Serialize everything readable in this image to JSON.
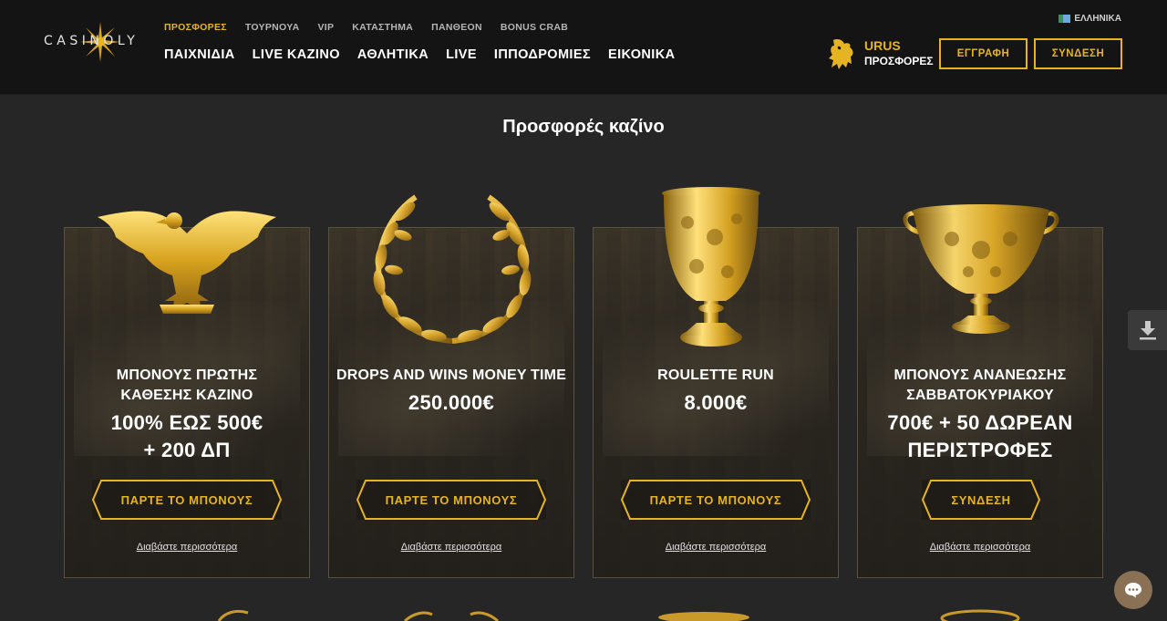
{
  "brand": {
    "logo_text": "CASINOLY"
  },
  "subnav": [
    "ΠΡΟΣΦΟΡΕΣ",
    "ΤΟΥΡΝΟΥΑ",
    "VIP",
    "ΚΑΤΑΣΤΗΜΑ",
    "ΠΑΝΘΕΟΝ",
    "BONUS CRAB"
  ],
  "mainnav": [
    "ΠΑΙΧΝΙΔΙΑ",
    "LIVE ΚΑΖΙΝΟ",
    "ΑΘΛΗΤΙΚΑ",
    "LIVE",
    "ΙΠΠΟΔΡΟΜΙΕΣ",
    "ΕΙΚΟΝΙΚΑ"
  ],
  "language": "ΕΛΛΗΝΙΚΑ",
  "promo": {
    "line1": "URUS",
    "line2": "ΠΡΟΣΦΟΡΕΣ"
  },
  "auth": {
    "register": "ΕΓΓΡΑΦΗ",
    "login": "ΣΥΝΔΕΣΗ"
  },
  "page_title": "Προσφορές καζίνο",
  "cards": [
    {
      "title_line1": "ΜΠΟΝΟΥΣ ΠΡΩΤΗΣ",
      "title_line2": "ΚΑΘΕΣΗΣ ΚΑΖΙΝΟ",
      "value_line1": "100% ΕΩΣ 500€",
      "value_line2": "+ 200 ΔΠ",
      "button": "ΠΑΡΤΕ ΤΟ ΜΠΟΝΟΥΣ",
      "more": "Διαβάστε περισσότερα"
    },
    {
      "title_line1": "DROPS AND WINS MONEY TIME",
      "value_line1": "250.000€",
      "button": "ΠΑΡΤΕ ΤΟ ΜΠΟΝΟΥΣ",
      "more": "Διαβάστε περισσότερα"
    },
    {
      "title_line1": "ROULETTE RUN",
      "value_line1": "8.000€",
      "button": "ΠΑΡΤΕ ΤΟ ΜΠΟΝΟΥΣ",
      "more": "Διαβάστε περισσότερα"
    },
    {
      "title_line1": "ΜΠΟΝΟΥΣ ΑΝΑΝΕΩΣΗΣ",
      "title_line2": "ΣΑΒΒΑΤΟΚΥΡΙΑΚΟΥ",
      "value_line1": "700€ + 50 ΔΩΡΕΑΝ",
      "value_line2": "ΠΕΡΙΣΤΡΟΦΕΣ",
      "button": "ΣΥΝΔΕΣΗ",
      "more": "Διαβάστε περισσότερα"
    }
  ],
  "icons": {
    "download": "download-icon",
    "chat": "chat-icon",
    "eagle": "eagle-icon",
    "laurel": "laurel-wreath-icon",
    "goblet": "goblet-icon",
    "chalice": "chalice-icon",
    "bull": "bull-icon"
  },
  "colors": {
    "accent": "#e6b422",
    "background": "#262626",
    "header": "#141414"
  }
}
